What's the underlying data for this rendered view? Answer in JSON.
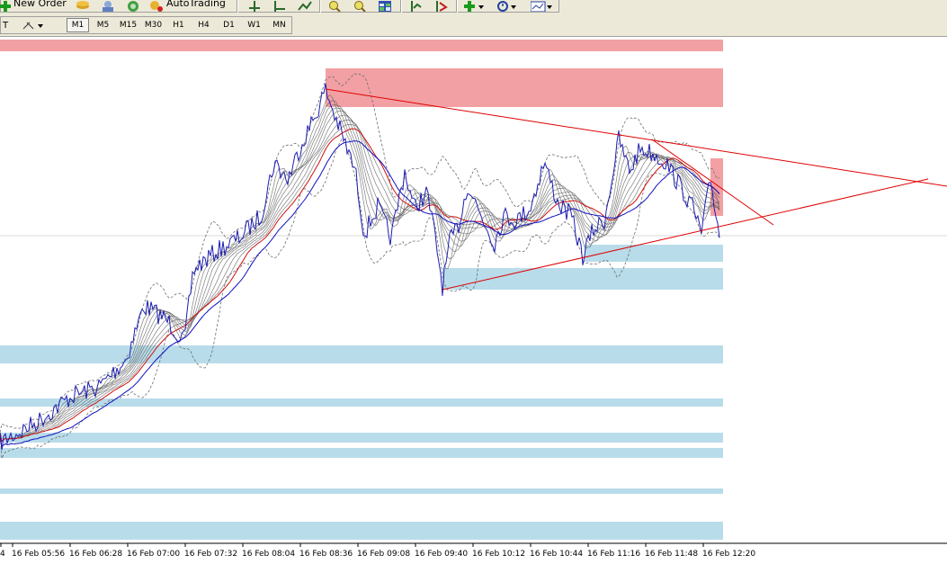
{
  "toolbar": {
    "new_order_label": "New Order",
    "auto_trading_label": "AutoTrading",
    "drawing_mode_label": "T",
    "icons": [
      "new-order-icon",
      "market-watch-icon",
      "navigator-icon",
      "strategy-tester-icon",
      "autotrading-icon",
      "crosshair-icon",
      "period-separator-icon",
      "zoom-in-icon",
      "zoom-out-icon",
      "tile-windows-icon",
      "chart-shift-icon",
      "autoscroll-icon",
      "indicators-icon",
      "periodicity-icon",
      "templates-icon"
    ],
    "timeframes": [
      "M1",
      "M5",
      "M15",
      "M30",
      "H1",
      "H4",
      "D1",
      "W1",
      "MN"
    ],
    "active_timeframe": "M1"
  },
  "chart": {
    "time_labels": [
      "4",
      "16 Feb 05:56",
      "16 Feb 06:28",
      "16 Feb 07:00",
      "16 Feb 07:32",
      "16 Feb 08:04",
      "16 Feb 08:36",
      "16 Feb 09:08",
      "16 Feb 09:40",
      "16 Feb 10:12",
      "16 Feb 10:44",
      "16 Feb 11:16",
      "16 Feb 11:48",
      "16 Feb 12:20"
    ],
    "colors": {
      "price_line": "#1c1cb0",
      "fast_ma": "#d01010",
      "slow_ma": "#1010c0",
      "ma_ribbon": "#606060",
      "bands": "#707070",
      "trendline": "#e00000",
      "supply_zone": "#f2a0a4",
      "demand_zone": "#b8dcea"
    }
  }
}
